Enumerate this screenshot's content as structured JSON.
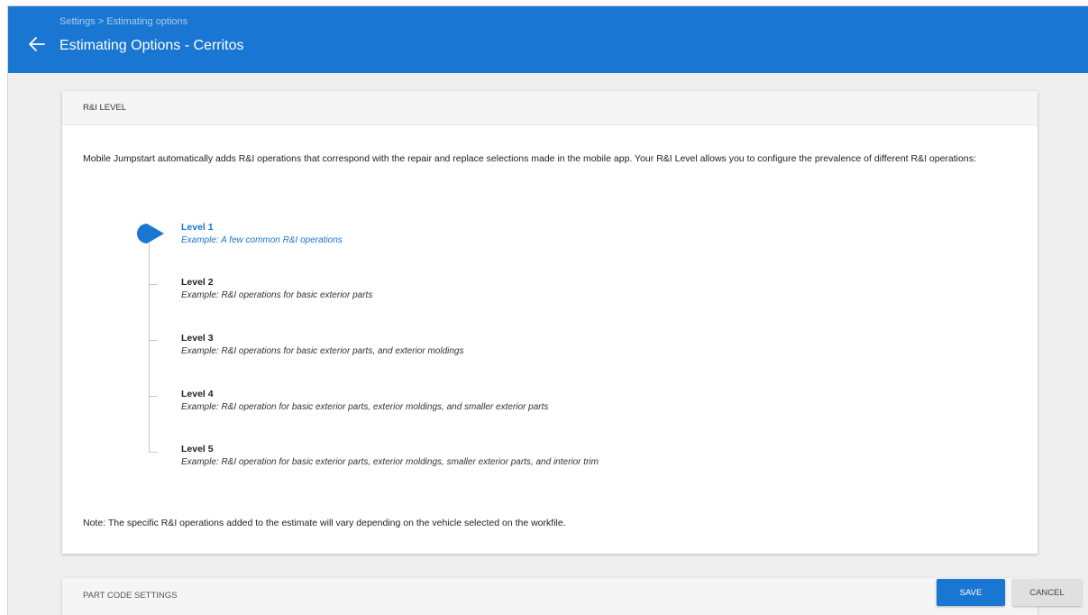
{
  "header": {
    "breadcrumb": "Settings > Estimating options",
    "title": "Estimating Options - Cerritos",
    "back_icon": "arrow-left-icon"
  },
  "colors": {
    "primary": "#1976d2",
    "background": "#efefef"
  },
  "rni_card": {
    "heading": "R&I LEVEL",
    "intro": "Mobile Jumpstart automatically adds R&I operations that correspond with the repair and replace selections made in the mobile app. Your R&I Level allows you to configure the prevalence of different R&I operations:",
    "selected_level": 1,
    "levels": [
      {
        "name": "Level 1",
        "example": "Example: A few common R&I operations"
      },
      {
        "name": "Level 2",
        "example": "Example: R&I operations for basic exterior parts"
      },
      {
        "name": "Level 3",
        "example": "Example: R&I operations for basic exterior parts, and exterior moldings"
      },
      {
        "name": "Level 4",
        "example": "Example: R&I operation for basic exterior parts, exterior moldings, and smaller exterior parts"
      },
      {
        "name": "Level 5",
        "example": "Example: R&I operation for basic exterior parts, exterior moldings, smaller exterior parts, and interior trim"
      }
    ],
    "note": "Note: The specific R&I operations added to the estimate will vary depending on the vehicle selected on the workfile."
  },
  "part_code_card": {
    "heading": "PART CODE SETTINGS"
  },
  "actions": {
    "save_label": "SAVE",
    "cancel_label": "CANCEL"
  }
}
